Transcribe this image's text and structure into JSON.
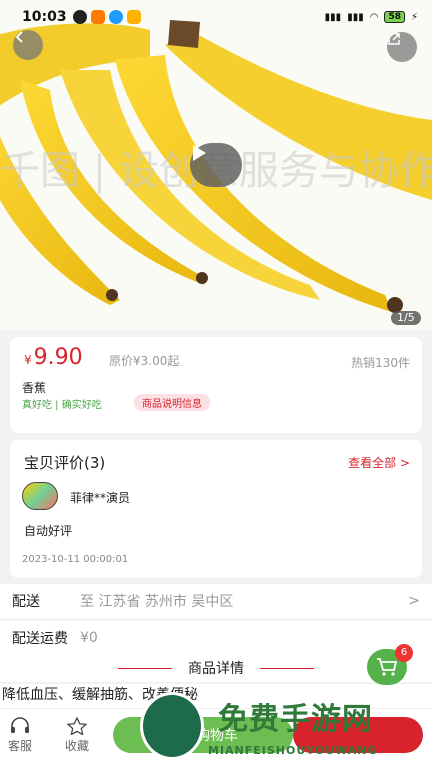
{
  "status_bar": {
    "time": "10:03",
    "battery": "58"
  },
  "hero": {
    "image_counter": "1/5",
    "watermark": "千图 |  设创意服务与协作平  资版权"
  },
  "product": {
    "currency": "¥",
    "price": "9.90",
    "original_price": "原价¥3.00起",
    "sales": "热销130件",
    "name": "香蕉",
    "tagline": "真好吃 | 确实好吃",
    "info_tag": "商品说明信息"
  },
  "reviews": {
    "title": "宝贝评价(3)",
    "view_all": "查看全部 >",
    "reviewer": "菲律**演员",
    "text": "自动好评",
    "date": "2023-10-11 00:00:01"
  },
  "shipping": {
    "label": "配送",
    "address": "至  江苏省  苏州市  吴中区",
    "chevron": ">",
    "fee_label": "配送运费",
    "fee_value": "¥0"
  },
  "details": {
    "title": "商品详情",
    "text": "降低血压、缓解抽筋、改善便秘"
  },
  "cart": {
    "badge_count": "6"
  },
  "bottom_bar": {
    "service": "客服",
    "favorite": "收藏",
    "add_to_cart": "加入购物车",
    "buy_now": ""
  },
  "overlay_logo": {
    "title": "免费手游网",
    "subtitle": "MIANFEISHOUYOUWANG"
  },
  "colors": {
    "accent_red": "#d9232c",
    "green": "#55b24a",
    "banana_yellow": "#f5cf2e"
  },
  "icons": [
    "back-arrow-icon",
    "share-icon",
    "play-icon",
    "headset-icon",
    "star-icon",
    "cart-icon"
  ]
}
